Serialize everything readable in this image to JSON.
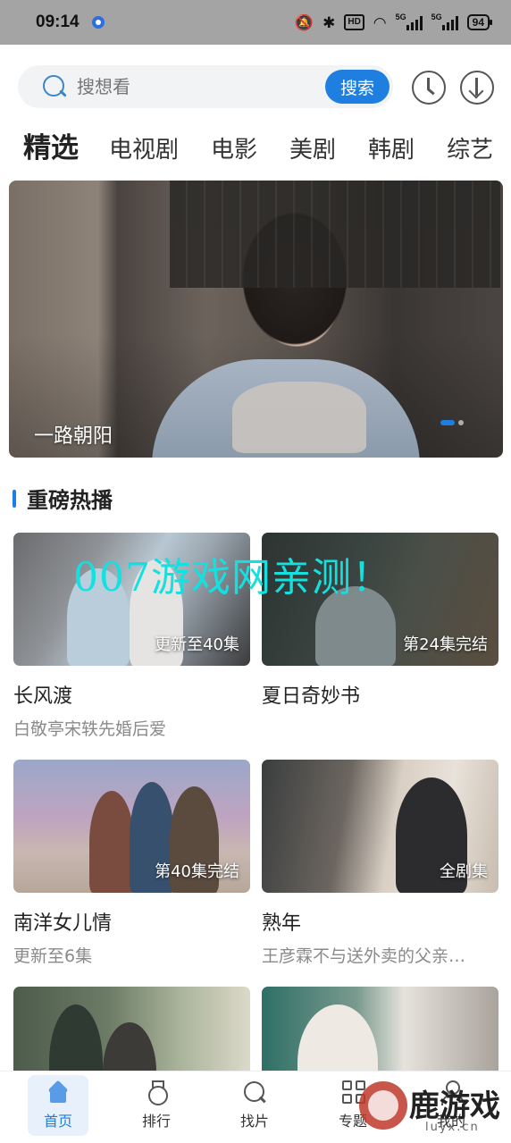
{
  "status_bar": {
    "time": "09:14",
    "hd": "HD",
    "net1": "5G",
    "net2": "5G",
    "battery": "94"
  },
  "search": {
    "placeholder": "搜想看",
    "button_label": "搜索"
  },
  "tabs": [
    {
      "label": "精选",
      "active": true
    },
    {
      "label": "电视剧",
      "active": false
    },
    {
      "label": "电影",
      "active": false
    },
    {
      "label": "美剧",
      "active": false
    },
    {
      "label": "韩剧",
      "active": false
    },
    {
      "label": "综艺",
      "active": false
    }
  ],
  "banner": {
    "title": "一路朝阳",
    "logo_text": "路朝阳"
  },
  "section": {
    "title": "重磅热播"
  },
  "cards": [
    {
      "title": "长风渡",
      "subtitle": "白敬亭宋轶先婚后爱",
      "badge": "更新至40集"
    },
    {
      "title": "夏日奇妙书",
      "subtitle": "",
      "badge": "第24集完结"
    },
    {
      "title": "南洋女儿情",
      "subtitle": "更新至6集",
      "badge": "第40集完结"
    },
    {
      "title": "熟年",
      "subtitle": "王彦霖不与送外卖的父亲…",
      "badge": "全剧集"
    },
    {
      "title": "",
      "subtitle": "",
      "badge": ""
    },
    {
      "title": "",
      "subtitle": "",
      "badge": ""
    }
  ],
  "watermark": "007游戏网亲测！",
  "bottom_nav": [
    {
      "label": "首页",
      "icon": "home-icon",
      "active": true
    },
    {
      "label": "排行",
      "icon": "rank-icon",
      "active": false
    },
    {
      "label": "找片",
      "icon": "search-icon",
      "active": false
    },
    {
      "label": "专题",
      "icon": "grid-icon",
      "active": false
    },
    {
      "label": "我的",
      "icon": "user-icon",
      "active": false
    }
  ],
  "site_logo": {
    "text": "鹿游戏",
    "url": "luyx.cn"
  },
  "colors": {
    "accent": "#1f7fe0",
    "status_bar_bg": "#a4a4a4",
    "watermark": "#14e0e0"
  }
}
